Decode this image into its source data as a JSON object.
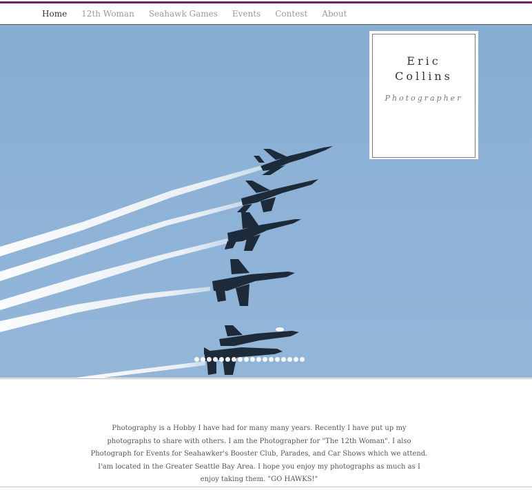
{
  "nav": {
    "items": [
      {
        "label": "Home",
        "active": true
      },
      {
        "label": "12th Woman",
        "active": false
      },
      {
        "label": "Seahawk Games",
        "active": false
      },
      {
        "label": "Events",
        "active": false
      },
      {
        "label": "Contest",
        "active": false
      },
      {
        "label": "About",
        "active": false
      }
    ]
  },
  "title_card": {
    "name_line1": "Eric",
    "name_line2": "Collins",
    "subtitle": "Photographer"
  },
  "slideshow": {
    "slide_count": 18,
    "current_slide": 1
  },
  "intro": {
    "text": "Photography is a Hobby I have had for many many years. Recently I have put up my photographs to share with others. I am the Photographer for \"The 12th Woman\". I also Photograph for Events for Seahawker's Booster Club, Parades, and Car Shows which we attend.  I'am located in the Greater Seattle Bay Area. I hope you enjoy my photographs as much as I enjoy taking them. \"GO HAWKS!\""
  },
  "colors": {
    "accent_bar": "#7a1f6e",
    "sky": "#8db2d6",
    "nav_active": "#333333",
    "nav_inactive": "#9a9a9a"
  }
}
